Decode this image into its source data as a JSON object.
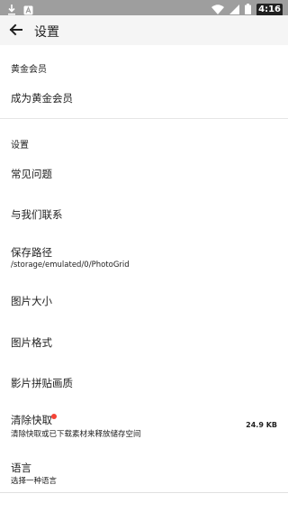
{
  "status_bar": {
    "time": "4:16",
    "icons": [
      "download-icon",
      "notification-a-icon",
      "wifi-icon",
      "signal-icon",
      "battery-icon"
    ]
  },
  "toolbar": {
    "title": "设置",
    "back_icon": "arrow-back-icon"
  },
  "sections": {
    "gold": {
      "header": "黄金会员",
      "items": [
        {
          "title": "成为黄金会员"
        }
      ]
    },
    "settings": {
      "header": "设置",
      "items": [
        {
          "title": "常见问题"
        },
        {
          "title": "与我们联系"
        },
        {
          "title": "保存路径",
          "subtitle": "/storage/emulated/0/PhotoGrid"
        },
        {
          "title": "图片大小"
        },
        {
          "title": "图片格式"
        },
        {
          "title": "影片拼贴画质"
        },
        {
          "title": "清除快取",
          "subtitle": "清除快取或已下载素材来释放储存空间",
          "value": "24.9 KB",
          "badge_color": "#f44336"
        },
        {
          "title": "语言",
          "subtitle": "选择一种语言"
        }
      ]
    }
  },
  "colors": {
    "status_bar": "#9e9e9e",
    "toolbar": "#f5f5f5",
    "background": "#ffffff",
    "badge": "#f44336"
  }
}
